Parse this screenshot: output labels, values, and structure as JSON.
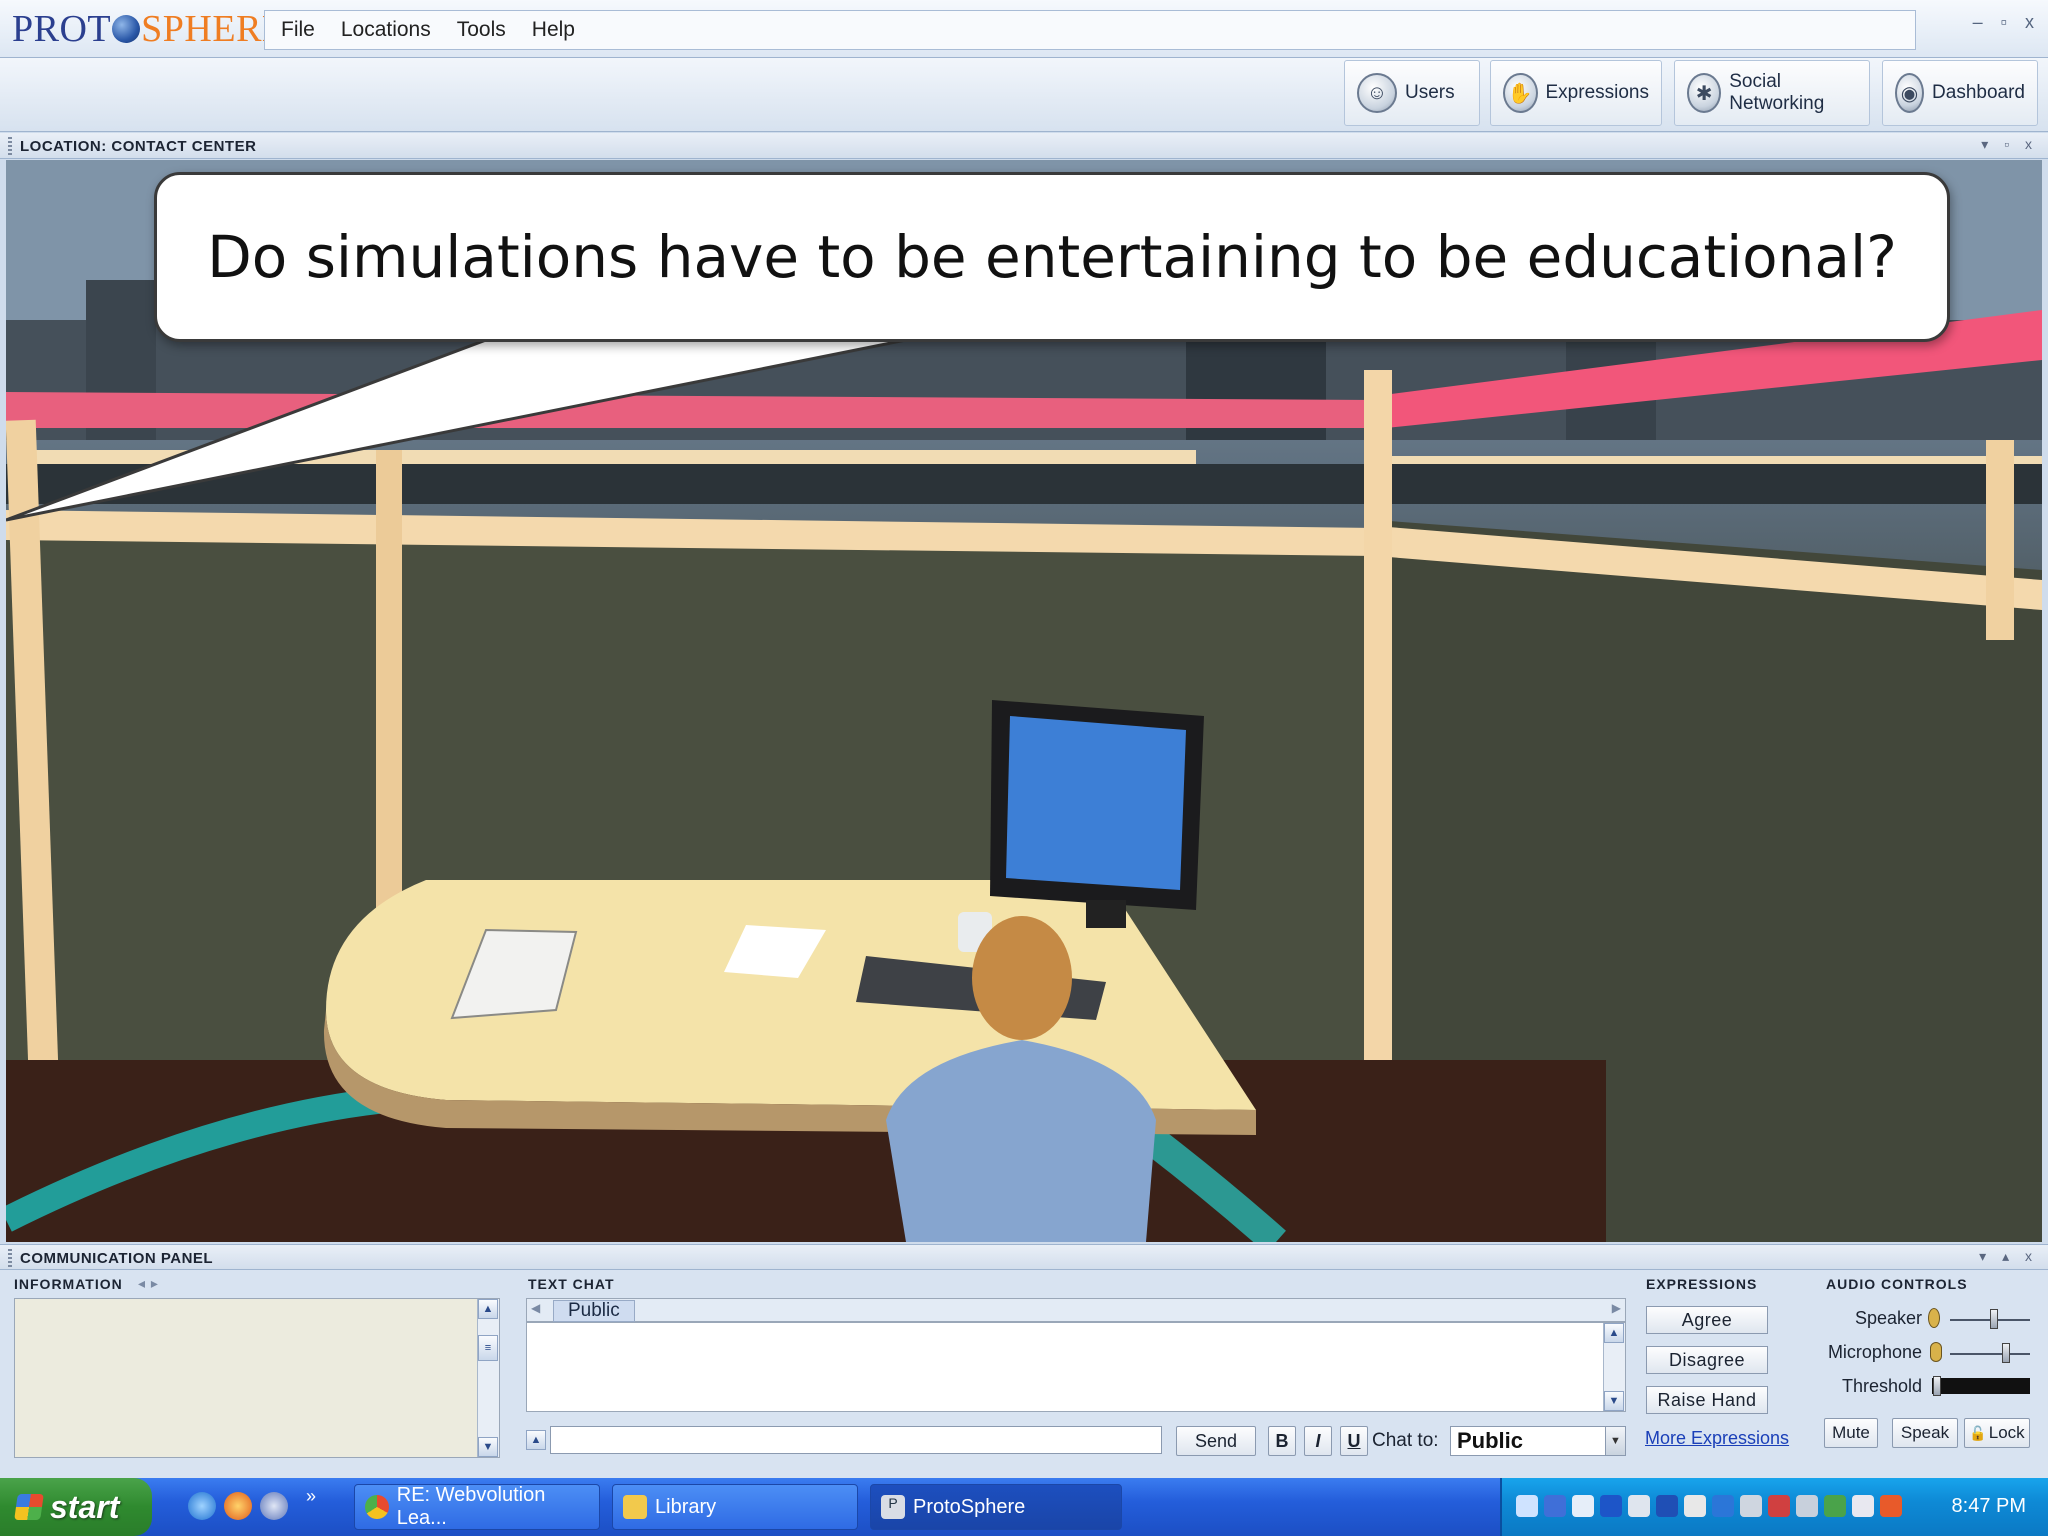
{
  "app": {
    "logo_proto": "PROT",
    "logo_sphere": "SPHERE",
    "logo_reg": "®"
  },
  "menu": [
    "File",
    "Locations",
    "Tools",
    "Help"
  ],
  "window_controls": [
    "–",
    "▫",
    "x"
  ],
  "toolbar": {
    "buttons": [
      {
        "label": "Users",
        "icon": "users-icon"
      },
      {
        "label": "Expressions",
        "icon": "expressions-icon"
      },
      {
        "label": "Social Networking",
        "icon": "social-networking-icon"
      },
      {
        "label": "Dashboard",
        "icon": "dashboard-icon"
      }
    ]
  },
  "location_panel": {
    "title": "LOCATION: CONTACT CENTER",
    "controls": "▾ ▫ x"
  },
  "scene": {
    "callout_text": "Do simulations have to be entertaining to be educational?"
  },
  "comm_panel": {
    "title": "COMMUNICATION PANEL",
    "controls": "▾ ▴ x",
    "information": {
      "label": "INFORMATION",
      "nav": "◂ ▸"
    },
    "text_chat": {
      "label": "TEXT CHAT",
      "tab": "Public",
      "input_value": "",
      "send_label": "Send",
      "bold_label": "B",
      "italic_label": "I",
      "underline_label": "U",
      "chat_to_label": "Chat to:",
      "chat_to_value": "Public"
    },
    "expressions": {
      "label": "EXPRESSIONS",
      "buttons": [
        "Agree",
        "Disagree",
        "Raise Hand"
      ],
      "more_link": "More Expressions"
    },
    "audio": {
      "label": "AUDIO CONTROLS",
      "speaker_label": "Speaker",
      "microphone_label": "Microphone",
      "threshold_label": "Threshold",
      "speaker_level": 0.55,
      "microphone_level": 0.7,
      "threshold_level": 0.05,
      "mute_label": "Mute",
      "speak_label": "Speak",
      "lock_label": "Lock"
    }
  },
  "taskbar": {
    "start_label": "start",
    "quick_launch_chevron": "»",
    "tasks": [
      {
        "label": "RE: Webvolution Lea...",
        "icon": "chrome-icon"
      },
      {
        "label": "Library",
        "icon": "folder-icon"
      },
      {
        "label": "ProtoSphere",
        "icon": "protosphere-icon"
      }
    ],
    "clock": "8:47 PM"
  }
}
